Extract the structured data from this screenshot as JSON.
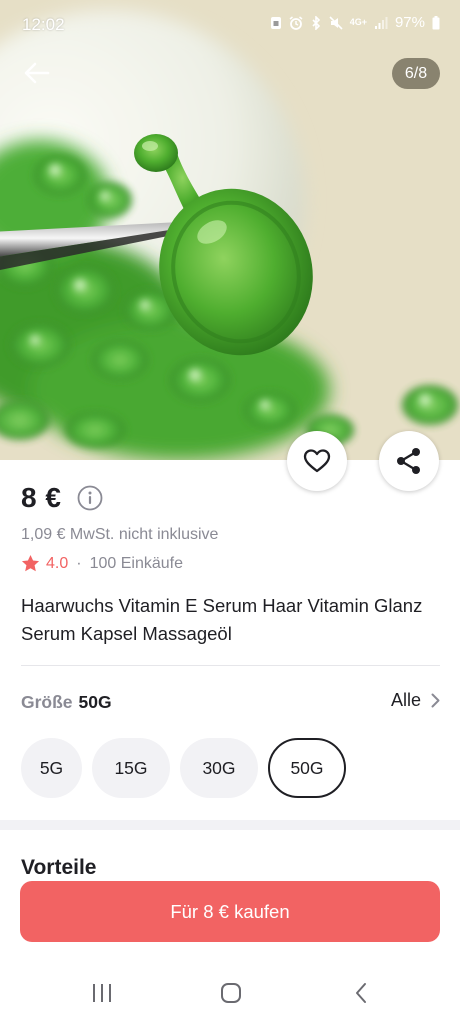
{
  "status_bar": {
    "time": "12:02",
    "icons": [
      "sim-icon",
      "alarm-icon",
      "bluetooth-icon",
      "mute-icon",
      "4g-icon",
      "signal-icon"
    ],
    "network_label": "4G+",
    "battery_percent": "97%"
  },
  "gallery": {
    "counter": "6/8",
    "back_icon": "arrow-left-icon",
    "current_image": 6,
    "total_images": 8
  },
  "actions": {
    "like_icon": "heart-outline-icon",
    "share_icon": "share-icon"
  },
  "product": {
    "price": "8 €",
    "price_info_icon": "info-icon",
    "vat_note": "1,09 € MwSt. nicht inklusive",
    "rating": "4.0",
    "rating_separator": "·",
    "purchases": "100 Einkäufe",
    "title": "Haarwuchs Vitamin E Serum Haar Vitamin Glanz Serum Kapsel Massageöl"
  },
  "size": {
    "label": "Größe",
    "selected": "50G",
    "all_label": "Alle",
    "options": [
      "5G",
      "15G",
      "30G",
      "50G"
    ]
  },
  "section": {
    "title": "Vorteile"
  },
  "cta": {
    "label": "Für 8 € kaufen"
  },
  "colors": {
    "accent": "#f26363",
    "text_primary": "#1f1f24",
    "text_secondary": "#8a8a94",
    "chip_bg": "#f2f2f5",
    "capsule_green": "#49a62d"
  }
}
